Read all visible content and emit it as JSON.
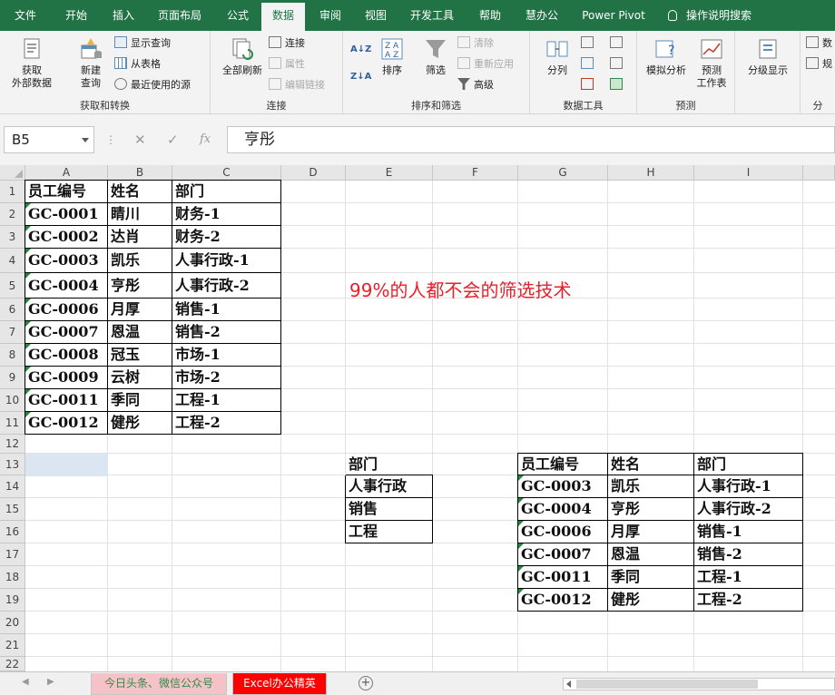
{
  "menu": {
    "tabs": [
      "文件",
      "开始",
      "插入",
      "页面布局",
      "公式",
      "数据",
      "审阅",
      "视图",
      "开发工具",
      "帮助",
      "慧办公",
      "Power Pivot"
    ],
    "active_tab": "数据",
    "help_search": "操作说明搜索"
  },
  "ribbon": {
    "get_transform": {
      "label": "获取和转换",
      "get_external_data": "获取\n外部数据",
      "new_query": "新建\n查询",
      "show_queries": "显示查询",
      "from_table": "从表格",
      "recent_sources": "最近使用的源"
    },
    "connections": {
      "label": "连接",
      "refresh_all": "全部刷新",
      "connections": "连接",
      "properties": "属性",
      "edit_links": "编辑链接"
    },
    "sort_filter": {
      "label": "排序和筛选",
      "sort": "排序",
      "filter": "筛选",
      "clear": "清除",
      "reapply": "重新应用",
      "advanced": "高级"
    },
    "data_tools": {
      "label": "数据工具",
      "text_to_columns": "分列"
    },
    "forecast": {
      "label": "预测",
      "what_if": "模拟分析",
      "forecast_sheet": "预测\n工作表"
    },
    "outline": {
      "label": "分",
      "group_show": "分级显示",
      "data_analysis": "数",
      "solver": "规"
    }
  },
  "formula_bar": {
    "name_box": "B5",
    "fx": "fx",
    "formula": "亨彤"
  },
  "columns": [
    "A",
    "B",
    "C",
    "D",
    "E",
    "F",
    "G",
    "H",
    "I"
  ],
  "rows": [
    "1",
    "2",
    "3",
    "4",
    "5",
    "6",
    "7",
    "8",
    "9",
    "10",
    "11",
    "12",
    "13",
    "14",
    "15",
    "16",
    "17",
    "18",
    "19",
    "20",
    "21",
    "22"
  ],
  "source_table": {
    "headers": [
      "员工编号",
      "姓名",
      "部门"
    ],
    "rows": [
      [
        "GC-0001",
        "睛川",
        "财务-1"
      ],
      [
        "GC-0002",
        "达肖",
        "财务-2"
      ],
      [
        "GC-0003",
        "凯乐",
        "人事行政-1"
      ],
      [
        "GC-0004",
        "亨彤",
        "人事行政-2"
      ],
      [
        "GC-0006",
        "月厚",
        "销售-1"
      ],
      [
        "GC-0007",
        "恩温",
        "销售-2"
      ],
      [
        "GC-0008",
        "冠玉",
        "市场-1"
      ],
      [
        "GC-0009",
        "云树",
        "市场-2"
      ],
      [
        "GC-0011",
        "季同",
        "工程-1"
      ],
      [
        "GC-0012",
        "健彤",
        "工程-2"
      ]
    ]
  },
  "criteria": {
    "header": "部门",
    "values": [
      "人事行政",
      "销售",
      "工程"
    ]
  },
  "result_table": {
    "headers": [
      "员工编号",
      "姓名",
      "部门"
    ],
    "rows": [
      [
        "GC-0003",
        "凯乐",
        "人事行政-1"
      ],
      [
        "GC-0004",
        "亨彤",
        "人事行政-2"
      ],
      [
        "GC-0006",
        "月厚",
        "销售-1"
      ],
      [
        "GC-0007",
        "恩温",
        "销售-2"
      ],
      [
        "GC-0011",
        "季同",
        "工程-1"
      ],
      [
        "GC-0012",
        "健彤",
        "工程-2"
      ]
    ]
  },
  "annotation": "99%的人都不会的筛选技术",
  "sheet_tabs": [
    "今日头条、微信公众号",
    "Excel办公精英"
  ],
  "active_sheet": "Excel办公精英",
  "colors": {
    "brand_green": "#217346",
    "annotation_red": "#e8202a",
    "active_sheet_tab": "#ff0000"
  }
}
